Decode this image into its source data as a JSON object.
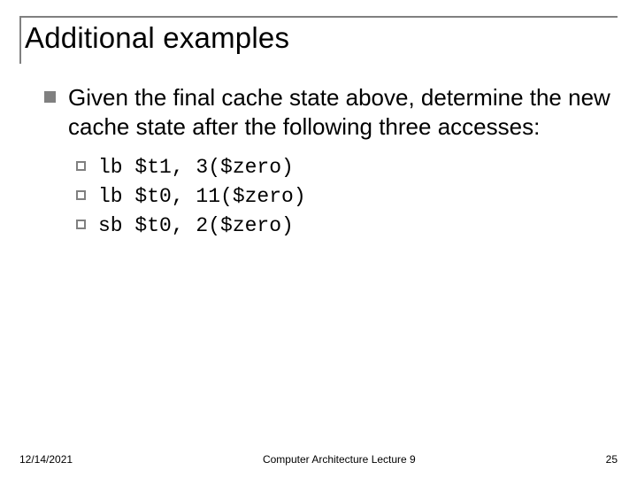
{
  "title": "Additional examples",
  "main_bullet": "Given the final cache state above, determine the new cache state after the following three accesses:",
  "code_items": [
    "lb $t1, 3($zero)",
    "lb $t0, 11($zero)",
    "sb $t0, 2($zero)"
  ],
  "footer": {
    "date": "12/14/2021",
    "center": "Computer Architecture Lecture 9",
    "page": "25"
  }
}
